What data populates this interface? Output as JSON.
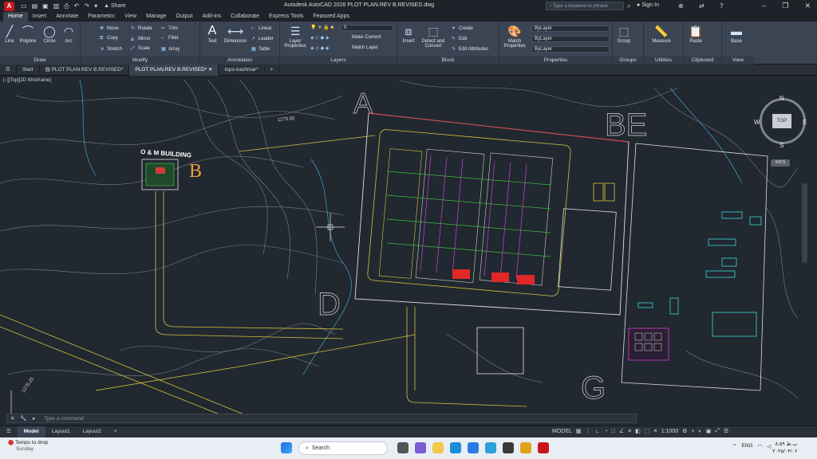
{
  "app": {
    "logo": "A",
    "title": "Autodesk AutoCAD 2026   PLOT PLAN.REV B.REVISED.dwg",
    "share": "Share",
    "search_placeholder": "Type a keyword or phrase",
    "signin": "Sign In"
  },
  "ribbon_tabs": [
    "Home",
    "Insert",
    "Annotate",
    "Parametric",
    "View",
    "Manage",
    "Output",
    "Add-ins",
    "Collaborate",
    "Express Tools",
    "Featured Apps"
  ],
  "ribbon": {
    "draw": {
      "title": "Draw",
      "line": "Line",
      "polyline": "Polyline",
      "circle": "Circle",
      "arc": "Arc"
    },
    "modify": {
      "title": "Modify",
      "move": "Move",
      "rotate": "Rotate",
      "trim": "Trim",
      "copy": "Copy",
      "mirror": "Mirror",
      "fillet": "Fillet",
      "stretch": "Stretch",
      "scale": "Scale",
      "array": "Array"
    },
    "annotation": {
      "title": "Annotation",
      "text": "Text",
      "dimension": "Dimension",
      "linear": "Linear",
      "leader": "Leader",
      "table": "Table"
    },
    "layers": {
      "title": "Layers",
      "layer_properties": "Layer Properties",
      "current_layer": "0",
      "make_current": "Make Current",
      "match_layer": "Match Layer"
    },
    "block": {
      "title": "Block",
      "insert": "Insert",
      "detect": "Detect and Convert",
      "create": "Create",
      "edit": "Edit",
      "edit_attributes": "Edit Attributes"
    },
    "properties": {
      "title": "Properties",
      "match": "Match Properties",
      "bylayer1": "ByLayer",
      "bylayer2": "ByLayer",
      "bylayer3": "ByLayer"
    },
    "groups": {
      "title": "Groups",
      "group": "Group"
    },
    "utilities": {
      "title": "Utilities",
      "measure": "Measure"
    },
    "clipboard": {
      "title": "Clipboard",
      "paste": "Paste"
    },
    "view": {
      "title": "View",
      "base": "Base"
    }
  },
  "file_tabs": [
    "Start",
    "PLOT PLAN.REV B.REVISED*",
    "PLOT PLAN.REV B.REVISED*",
    "topo-kashmar*"
  ],
  "viewport_label": "[–][Top][2D Wireframe]",
  "drawing": {
    "om_building": "O & M BUILDING",
    "letter_b": "B",
    "letter_a": "A",
    "letter_be": "BE",
    "letter_d": "D",
    "letter_g": "G",
    "contour_label_1": "1275.00",
    "contour_label_2": "1275.25"
  },
  "viewcube": {
    "n": "N",
    "s": "S",
    "e": "E",
    "w": "W",
    "top": "TOP",
    "wcs": "WCS"
  },
  "command_placeholder": "Type a command",
  "status": {
    "model_tab": "Model",
    "layout1": "Layout1",
    "layout2": "Layout2",
    "model_btn": "MODEL",
    "scale": "1:1000"
  },
  "taskbar": {
    "weather_title": "Temps to drop",
    "weather_day": "Sunday",
    "search": "Search",
    "lang": "ENG",
    "clock_time": "۸:۵۹ ب.ظ",
    "clock_date": "۲۰۲۵/۰۴/۰۶"
  },
  "colors": {
    "accent": "#c8161d",
    "ribbon": "#3b4453",
    "canvas": "#212830"
  }
}
